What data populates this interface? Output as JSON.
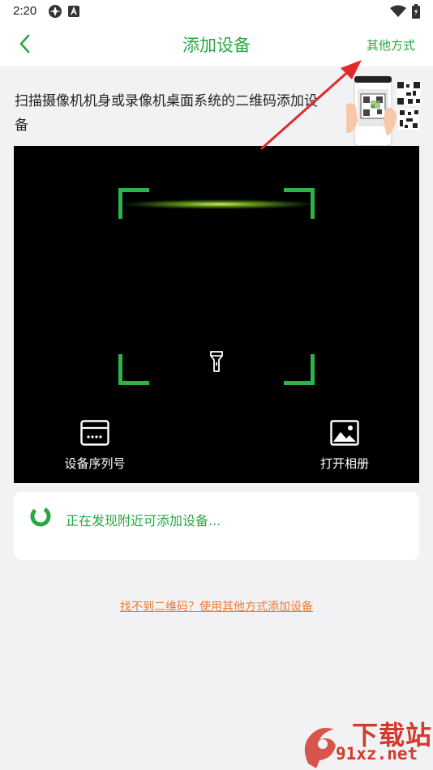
{
  "status_bar": {
    "time": "2:20",
    "icons": [
      "app-notification-icon",
      "a-badge-icon",
      "wifi-icon",
      "battery-icon"
    ]
  },
  "header": {
    "back_icon": "chevron-left-icon",
    "title": "添加设备",
    "other_ways": "其他方式"
  },
  "instruction": {
    "text": "扫描摄像机机身或录像机桌面系统的二维码添加设备"
  },
  "scanner": {
    "flashlight_icon": "flashlight-icon",
    "actions": [
      {
        "label": "设备序列号",
        "icon": "serial-number-icon"
      },
      {
        "label": "打开相册",
        "icon": "image-icon"
      }
    ]
  },
  "discover": {
    "text": "正在发现附近可添加设备..."
  },
  "bottom_link": {
    "text": "找不到二维码？使用其他方式添加设备"
  },
  "watermark": {
    "title": "下载站",
    "domain": "91xz.net"
  },
  "colors": {
    "accent_green": "#29a745",
    "frame_green": "#2db34a",
    "link_orange": "#ef7a2e",
    "annotation_red": "#e02a2a",
    "watermark_red": "#d23a2e"
  }
}
